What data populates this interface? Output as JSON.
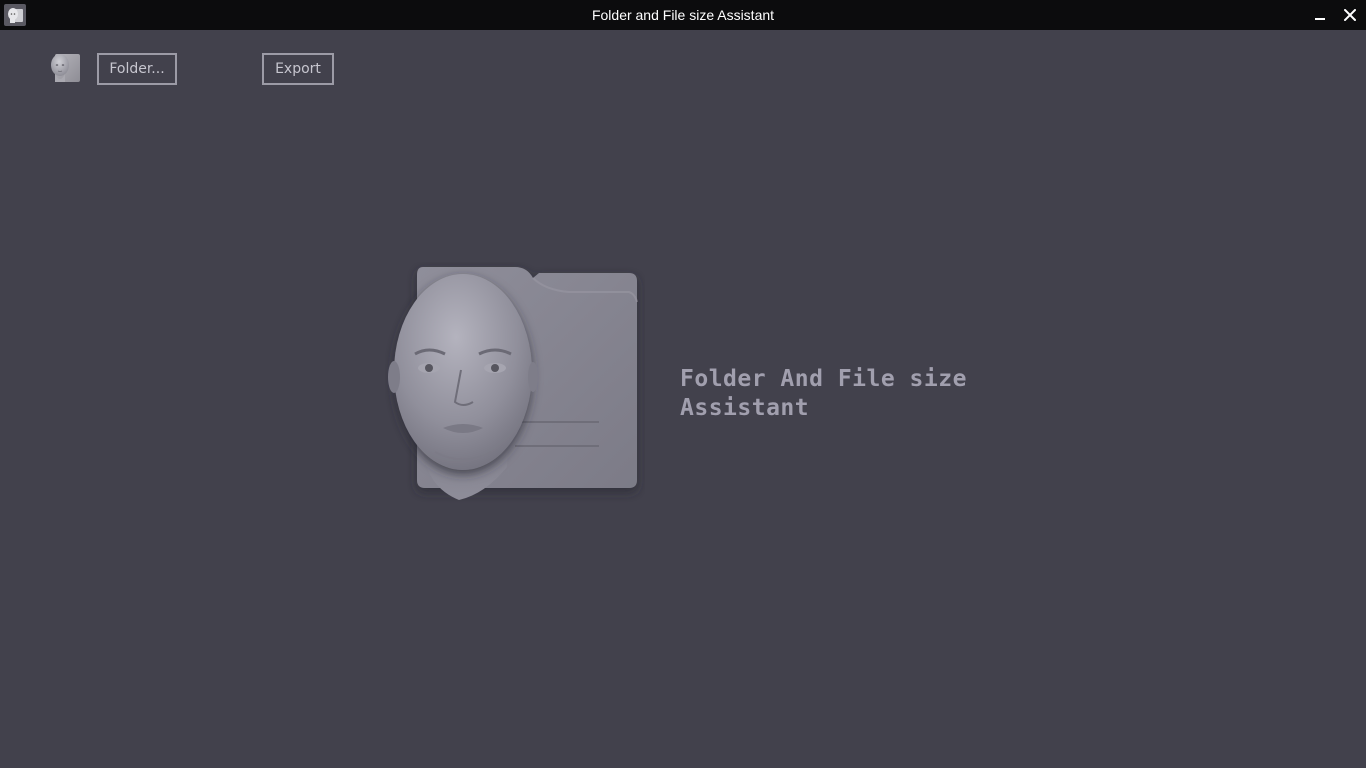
{
  "window": {
    "title": "Folder and File size Assistant",
    "minimize_icon": "minimize-icon",
    "close_icon": "close-icon"
  },
  "toolbar": {
    "folder_label": "Folder...",
    "export_label": "Export"
  },
  "hero": {
    "text": "Folder And File size Assistant"
  },
  "colors": {
    "background": "#42414c",
    "titlebar": "#0c0c0d",
    "button_border": "#9c9ba6",
    "button_text": "#c7c6cf",
    "hero_text": "#a19fae"
  }
}
